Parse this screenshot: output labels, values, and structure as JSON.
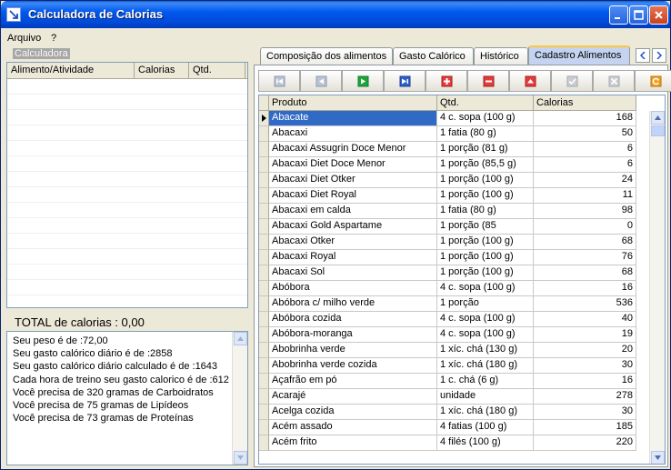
{
  "window": {
    "title": "Calculadora de Calorias",
    "accent": "#0058ee",
    "close_color": "#c9401f"
  },
  "menu": [
    "Arquivo",
    "?"
  ],
  "left": {
    "group_title": "Calculadora",
    "columns": [
      "Alimento/Atividade",
      "Calorias",
      "Qtd."
    ],
    "total_label": "TOTAL de calorias : 0,00",
    "info_lines": [
      "Seu peso é de :72,00",
      "Seu gasto calórico diário é de :2858",
      "Seu gasto calórico diário calculado é de :1643",
      "Cada hora de treino seu gasto calorico é de :612",
      "Você precisa de 320 gramas de Carboidratos",
      "Você precisa de  75 gramas de Lipídeos",
      "Você precisa de  73 gramas de Proteínas"
    ]
  },
  "tabs": [
    "Composição dos alimentos",
    "Gasto Calórico",
    "Histórico",
    "Cadastro Alimentos"
  ],
  "active_tab": "Cadastro Alimentos",
  "toolbar": [
    "first-icon",
    "prior-icon",
    "next-icon",
    "last-icon",
    "insert-icon",
    "delete-icon",
    "edit-icon",
    "post-icon",
    "cancel-icon",
    "refresh-icon"
  ],
  "grid": {
    "columns": [
      "Produto",
      "Qtd.",
      "Calorias"
    ],
    "rows": [
      [
        "Abacate",
        "4 c. sopa (100 g)",
        "168"
      ],
      [
        "Abacaxi",
        "1 fatia (80 g)",
        "50"
      ],
      [
        "Abacaxi Assugrin Doce Menor",
        "1 porção (81 g)",
        "6"
      ],
      [
        "Abacaxi Diet Doce Menor",
        "1 porção (85,5 g)",
        "6"
      ],
      [
        "Abacaxi Diet Otker",
        "1 porção (100 g)",
        "24"
      ],
      [
        "Abacaxi Diet Royal",
        "1 porção (100 g)",
        "11"
      ],
      [
        "Abacaxi em calda",
        "1 fatia (80 g)",
        "98"
      ],
      [
        "Abacaxi Gold Aspartame",
        "1 porção (85",
        "0"
      ],
      [
        "Abacaxi Otker",
        "1 porção (100 g)",
        "68"
      ],
      [
        "Abacaxi Royal",
        "1 porção (100 g)",
        "76"
      ],
      [
        "Abacaxi Sol",
        "1 porção (100 g)",
        "68"
      ],
      [
        "Abóbora",
        "4 c. sopa (100 g)",
        "16"
      ],
      [
        "Abóbora c/ milho verde",
        "1 porção",
        "536"
      ],
      [
        "Abóbora cozida",
        "4 c. sopa (100 g)",
        "40"
      ],
      [
        "Abóbora-moranga",
        "4 c. sopa (100 g)",
        "19"
      ],
      [
        "Abobrinha verde",
        "1 xíc. chá (130 g)",
        "20"
      ],
      [
        "Abobrinha verde cozida",
        "1 xíc. chá (180 g)",
        "30"
      ],
      [
        "Açafrão em pó",
        "1 c. chá (6 g)",
        "16"
      ],
      [
        "Acarajé",
        "unidade",
        "278"
      ],
      [
        "Acelga cozida",
        "1 xíc. chá (180 g)",
        "30"
      ],
      [
        "Acém assado",
        "4 fatias (100 g)",
        "185"
      ],
      [
        "Acém frito",
        "4 filés (100 g)",
        "220"
      ]
    ],
    "selected_row": 0
  }
}
